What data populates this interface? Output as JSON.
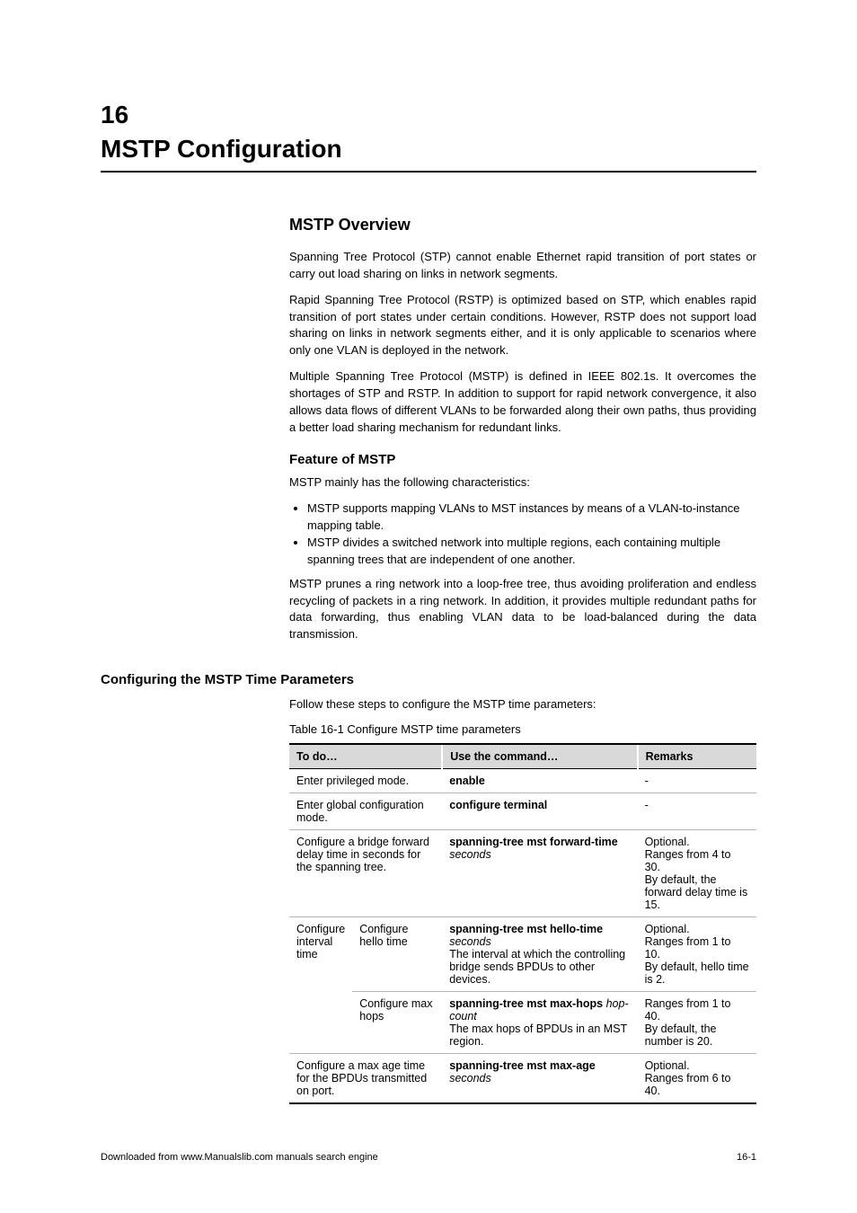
{
  "chapter": {
    "label": "16",
    "title": "MSTP Configuration"
  },
  "overview": {
    "heading": "MSTP Overview",
    "para1": "Spanning Tree Protocol (STP) cannot enable Ethernet rapid transition of port states or carry out load sharing on links in network segments.",
    "para2": "Rapid Spanning Tree Protocol (RSTP) is optimized based on STP, which enables rapid transition of port states under certain conditions. However, RSTP does not support load sharing on links in network segments either, and it is only applicable to scenarios where only one VLAN is deployed in the network.",
    "para3": "Multiple Spanning Tree Protocol (MSTP) is defined in IEEE 802.1s. It overcomes the shortages of STP and RSTP. In addition to support for rapid network convergence, it also allows data flows of different VLANs to be forwarded along their own paths, thus providing a better load sharing mechanism for redundant links.",
    "feature_heading": "Feature of MSTP",
    "fp1": "MSTP mainly has the following characteristics:",
    "bullets": [
      "MSTP supports mapping VLANs to MST instances by means of a VLAN-to-instance mapping table.",
      "MSTP divides a switched network into multiple regions, each containing multiple spanning trees that are independent of one another."
    ],
    "fp2": "MSTP prunes a ring network into a loop-free tree, thus avoiding proliferation and endless recycling of packets in a ring network. In addition, it provides multiple redundant paths for data forwarding, thus enabling VLAN data to be load-balanced during the data transmission."
  },
  "config_section": {
    "title": "Configuring the MSTP Time Parameters",
    "intro": "Follow these steps to configure the MSTP time parameters:",
    "table_caption": "Table 16-1 Configure MSTP time parameters"
  },
  "table": {
    "headers": [
      "To do…",
      "Use the command…",
      "Remarks"
    ],
    "rows": [
      {
        "todo": "Enter privileged mode.",
        "cmd_prefix": "",
        "cmd": "enable",
        "cmd_suffix": "",
        "remarks": "-"
      },
      {
        "todo": "Enter global configuration mode.",
        "cmd_prefix": "",
        "cmd": "configure terminal",
        "cmd_suffix": "",
        "remarks": "-"
      },
      {
        "todo": "Configure a bridge forward delay time in seconds for the spanning tree.",
        "cmd_prefix": "",
        "cmd": "spanning-tree mst forward-time",
        "cmd_suffix_html": " <span class='ital'>seconds</span>",
        "remarks_html": "Optional.<br>Ranges from 4 to 30.<br>By default, the forward delay time is 15."
      },
      {
        "group_label": "Configure interval time",
        "sublabel": "Configure hello time",
        "cmd": "spanning-tree mst hello-time",
        "cmd_suffix_html": " <span class='ital'>seconds</span>",
        "sub2_html": "The interval at which the controlling bridge sends BPDUs to other devices.",
        "remarks_html": "Optional.<br>Ranges from 1 to 10.<br>By default, hello time is 2."
      },
      {
        "sublabel": "Configure max hops",
        "cmd": "spanning-tree mst max-hops",
        "cmd_suffix_html": " <span class='ital'>hop-count</span>",
        "sub2_html": "The max hops of BPDUs in an MST region.",
        "remarks_html": "Ranges from 1 to 40.<br>By default, the number is 20."
      },
      {
        "todo": "Configure a max age time for the BPDUs transmitted on port.",
        "cmd": "spanning-tree mst max-age",
        "cmd_suffix_html": " <span class='ital'>seconds</span>",
        "remarks_html": "Optional.<br>Ranges from 6 to 40."
      }
    ]
  },
  "footer": {
    "left": "Downloaded from www.Manualslib.com manuals search engine",
    "right": "16-1"
  }
}
